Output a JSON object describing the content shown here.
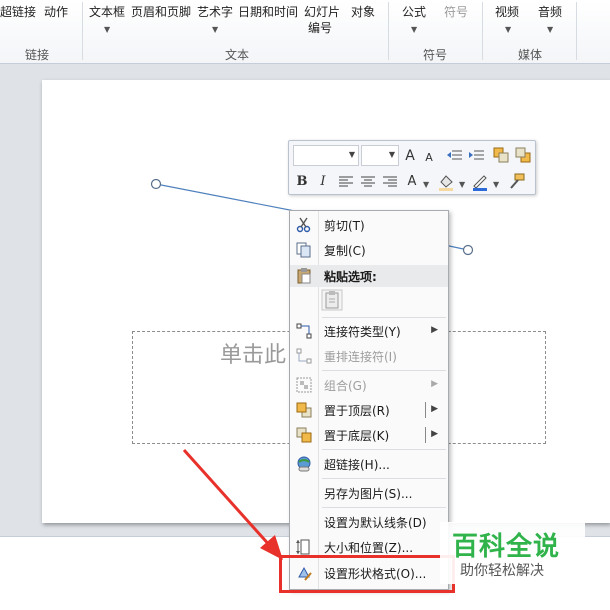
{
  "ribbon": {
    "items": {
      "hyperlink": "超链接",
      "action": "动作",
      "textbox": "文本框",
      "header_footer": "页眉和页脚",
      "wordart": "艺术字",
      "date_time": "日期和时间",
      "slide_number_line1": "幻灯片",
      "slide_number_line2": "编号",
      "object": "对象",
      "equation": "公式",
      "symbol": "符号",
      "video": "视频",
      "audio": "音频"
    },
    "groups": {
      "links": "链接",
      "text": "文本",
      "symbols": "符号",
      "media": "媒体"
    }
  },
  "slide": {
    "placeholder_text": "单击此"
  },
  "mini_toolbar": {
    "bold": "B",
    "italic": "I",
    "grow_font": "A",
    "shrink_font": "A",
    "font_color_letter": "A"
  },
  "context_menu": {
    "items": [
      {
        "label": "剪切(T)",
        "enabled": true
      },
      {
        "label": "复制(C)",
        "enabled": true
      },
      {
        "label": "粘贴选项:",
        "enabled": true
      },
      {
        "label": "连接符类型(Y)",
        "enabled": true
      },
      {
        "label": "重排连接符(I)",
        "enabled": false
      },
      {
        "label": "组合(G)",
        "enabled": false
      },
      {
        "label": "置于顶层(R)",
        "enabled": true
      },
      {
        "label": "置于底层(K)",
        "enabled": true
      },
      {
        "label": "超链接(H)...",
        "enabled": true
      },
      {
        "label": "另存为图片(S)...",
        "enabled": true
      },
      {
        "label": "设置为默认线条(D)",
        "enabled": true
      },
      {
        "label": "大小和位置(Z)...",
        "enabled": true
      },
      {
        "label": "设置形状格式(O)...",
        "enabled": true
      }
    ]
  },
  "watermark": {
    "title": "百科全说",
    "subtitle": "助你轻松解决"
  },
  "colors": {
    "highlight": "#e8312a",
    "watermark_green": "#2fb34a",
    "line": "#4f81bd"
  }
}
